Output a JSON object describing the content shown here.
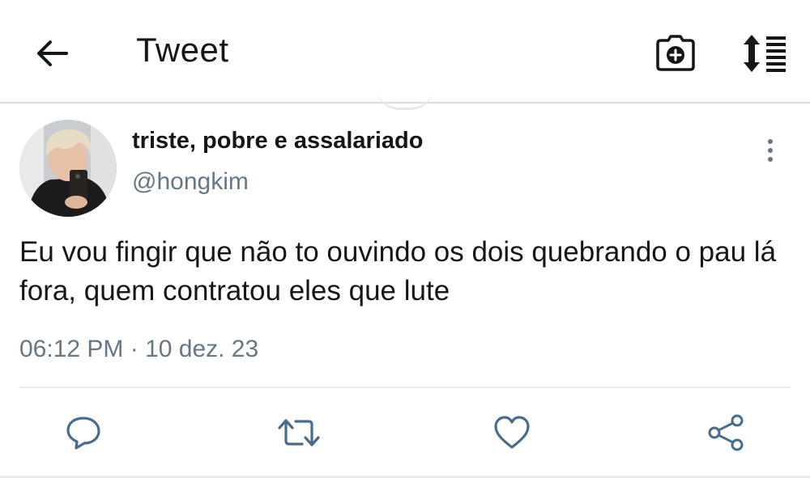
{
  "header": {
    "title": "Tweet",
    "back_icon": "arrow-left-icon",
    "camera_icon": "camera-plus-icon",
    "sort_icon": "sort-list-icon"
  },
  "tweet": {
    "display_name": "triste, pobre e assalariado",
    "handle": "@hongkim",
    "text": "Eu vou fingir que não to ouvindo os dois quebrando o pau lá fora, quem contratou eles que lute",
    "timestamp": "06:12 PM · 10 dez. 23"
  },
  "actions": [
    {
      "name": "reply",
      "icon": "reply-icon"
    },
    {
      "name": "retweet",
      "icon": "retweet-icon"
    },
    {
      "name": "like",
      "icon": "heart-icon"
    },
    {
      "name": "share",
      "icon": "share-icon"
    }
  ],
  "colors": {
    "text_primary": "#14171a",
    "text_secondary": "#657786",
    "divider": "#e6ecf0",
    "icon_blue": "#4a6c8c"
  }
}
